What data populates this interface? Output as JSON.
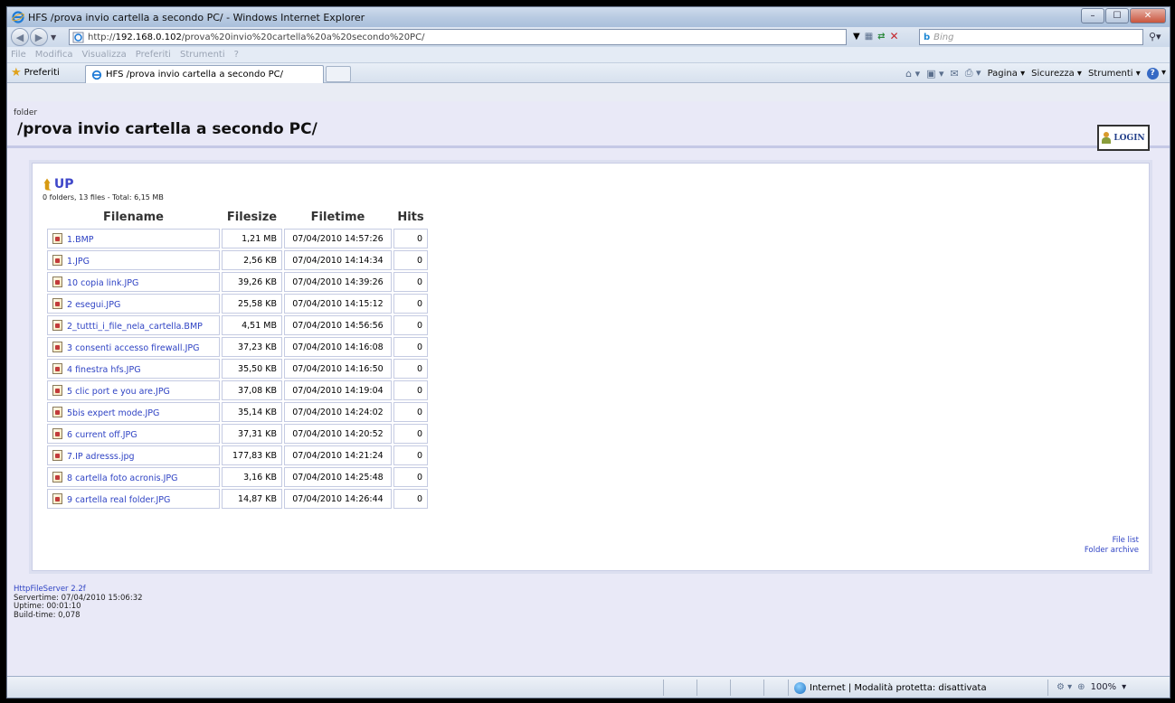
{
  "window": {
    "title": "HFS /prova invio cartella a secondo PC/ - Windows Internet Explorer",
    "caption_buttons": [
      "–",
      "☐",
      "✕"
    ]
  },
  "address_bar": {
    "url_prefix": "http://",
    "url_host": "192.168.0.102",
    "url_path": "/prova%20invio%20cartella%20a%20secondo%20PC/",
    "search_placeholder": "Bing",
    "search_provider": "b"
  },
  "menu": [
    "File",
    "Modifica",
    "Visualizza",
    "Preferiti",
    "Strumenti",
    "?"
  ],
  "favorites_bar": {
    "favorites_label": "Preferiti",
    "tab_title": "HFS /prova invio cartella a secondo PC/",
    "commands": [
      "Pagina",
      "Sicurezza",
      "Strumenti"
    ]
  },
  "page": {
    "folder_label": "folder",
    "folder_title": "/prova invio cartella a secondo PC/",
    "login_label": "LOGIN",
    "up_label": "UP",
    "summary": "0 folders, 13 files - Total: 6,15 MB",
    "table": {
      "headers": [
        "Filename",
        "Filesize",
        "Filetime",
        "Hits"
      ],
      "rows": [
        {
          "name": "1.BMP",
          "size": "1,21 MB",
          "time": "07/04/2010 14:57:26",
          "hits": "0"
        },
        {
          "name": "1.JPG",
          "size": "2,56 KB",
          "time": "07/04/2010 14:14:34",
          "hits": "0"
        },
        {
          "name": "10 copia link.JPG",
          "size": "39,26 KB",
          "time": "07/04/2010 14:39:26",
          "hits": "0"
        },
        {
          "name": "2 esegui.JPG",
          "size": "25,58 KB",
          "time": "07/04/2010 14:15:12",
          "hits": "0"
        },
        {
          "name": "2_tuttti_i_file_nela_cartella.BMP",
          "size": "4,51 MB",
          "time": "07/04/2010 14:56:56",
          "hits": "0"
        },
        {
          "name": "3 consenti accesso firewall.JPG",
          "size": "37,23 KB",
          "time": "07/04/2010 14:16:08",
          "hits": "0"
        },
        {
          "name": "4 finestra hfs.JPG",
          "size": "35,50 KB",
          "time": "07/04/2010 14:16:50",
          "hits": "0"
        },
        {
          "name": "5 clic port e you are.JPG",
          "size": "37,08 KB",
          "time": "07/04/2010 14:19:04",
          "hits": "0"
        },
        {
          "name": "5bis expert mode.JPG",
          "size": "35,14 KB",
          "time": "07/04/2010 14:24:02",
          "hits": "0"
        },
        {
          "name": "6 current off.JPG",
          "size": "37,31 KB",
          "time": "07/04/2010 14:20:52",
          "hits": "0"
        },
        {
          "name": "7.IP adresss.jpg",
          "size": "177,83 KB",
          "time": "07/04/2010 14:21:24",
          "hits": "0"
        },
        {
          "name": "8 cartella foto acronis.JPG",
          "size": "3,16 KB",
          "time": "07/04/2010 14:25:48",
          "hits": "0"
        },
        {
          "name": "9 cartella real folder.JPG",
          "size": "14,87 KB",
          "time": "07/04/2010 14:26:44",
          "hits": "0"
        }
      ]
    },
    "links": {
      "file_list": "File list",
      "folder_archive": "Folder archive"
    },
    "footer": {
      "server": "HttpFileServer 2.2f",
      "servertime": "Servertime: 07/04/2010 15:06:32",
      "uptime": "Uptime: 00:01:10",
      "buildtime": "Build-time: 0,078"
    }
  },
  "status_bar": {
    "zone": "Internet | Modalità protetta: disattivata",
    "zoom": "100%"
  }
}
